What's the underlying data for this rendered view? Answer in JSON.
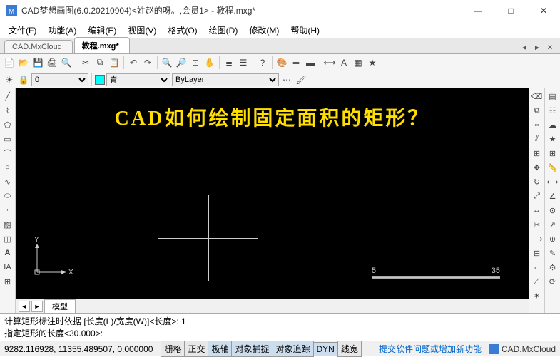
{
  "window": {
    "title": "CAD梦想画图(6.0.20210904)<姓赵的呀。,会员1> - 教程.mxg*",
    "min": "—",
    "max": "□",
    "close": "✕"
  },
  "menu": [
    "文件(F)",
    "功能(A)",
    "编辑(E)",
    "视图(V)",
    "格式(O)",
    "绘图(D)",
    "修改(M)",
    "帮助(H)"
  ],
  "tabs": {
    "inactive": "CAD.MxCloud",
    "active": "教程.mxg*"
  },
  "props": {
    "color_label": "青",
    "linetype": "ByLayer"
  },
  "canvas": {
    "headline": "CAD如何绘制固定面积的矩形？",
    "ucs_x": "X",
    "ucs_y": "Y",
    "ruler_left": "5",
    "ruler_right": "35",
    "model_tab": "模型"
  },
  "command": {
    "line1": "计算矩形标注时依据 [长度(L)/宽度(W)]<长度>: 1",
    "line2_prefix": "指定矩形的长度<30.000>: ",
    "line2_value": ""
  },
  "status": {
    "coords": "9282.116928, 11355.489507, 0.000000",
    "buttons": [
      "栅格",
      "正交",
      "极轴",
      "对象捕捉",
      "对象追踪",
      "DYN",
      "线宽"
    ],
    "active": [
      2,
      3,
      4,
      5
    ],
    "link": "提交软件问题或增加新功能",
    "brand": "CAD.MxCloud"
  }
}
